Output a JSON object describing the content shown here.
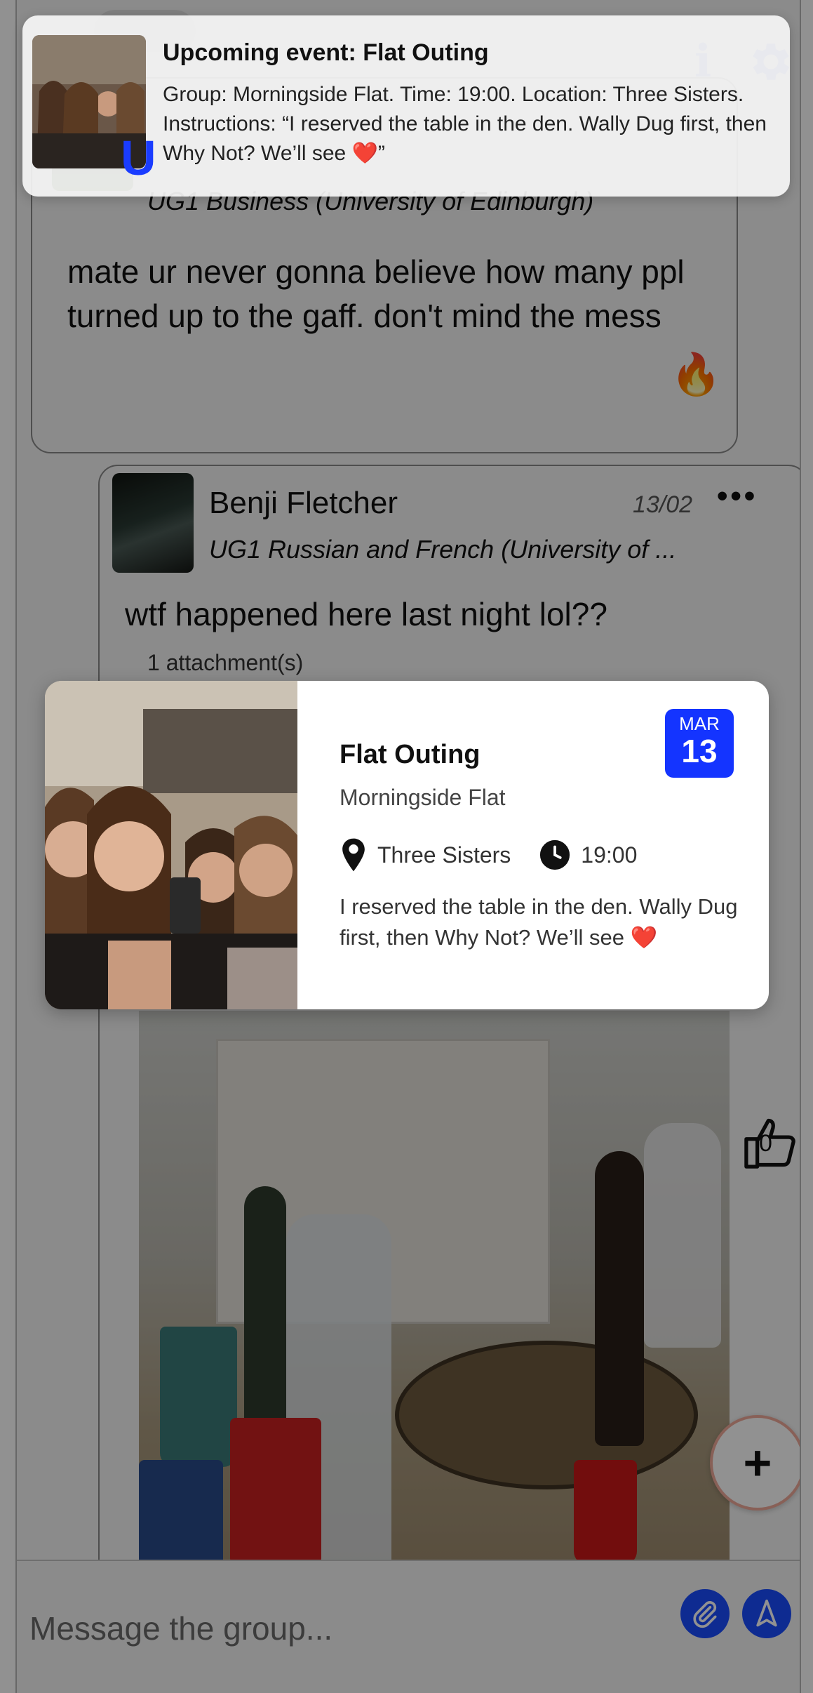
{
  "posts": [
    {
      "subtitle": "UG1 Business (University of Edinburgh)",
      "message": "mate ur never gonna believe how many ppl turned up to the gaff. don't mind the mess",
      "reaction_icon": "fire-icon"
    },
    {
      "author": "Benji Fletcher",
      "date": "13/02",
      "subtitle": "UG1 Russian and French (University of ...",
      "message": "wtf happened here last night lol??",
      "attachments": "1 attachment(s)",
      "reaction_icon": "thumbs-up-icon",
      "likes": "0"
    }
  ],
  "post_menu": "•••",
  "fab_label": "+",
  "composer": {
    "placeholder": "Message the group..."
  },
  "notification": {
    "title": "Upcoming event: Flat Outing",
    "body": "Group: Morningside Flat. Time: 19:00. Location: Three Sisters. Instructions: “I reserved the table in the den. Wally Dug first, then Why Not? We’ll see ❤️”",
    "logo_letter": "U"
  },
  "event_card": {
    "title": "Flat Outing",
    "group": "Morningside Flat",
    "location": "Three Sisters",
    "time": "19:00",
    "description": "I reserved the table in the den. Wally Dug first, then Why Not? We’ll see ❤️",
    "month": "MAR",
    "day": "13"
  },
  "colors": {
    "accent": "#1a4dff",
    "calendar_badge": "#1434ff",
    "info_icon": "#6b86ff",
    "overlay": "rgba(0,0,0,0.43)"
  }
}
